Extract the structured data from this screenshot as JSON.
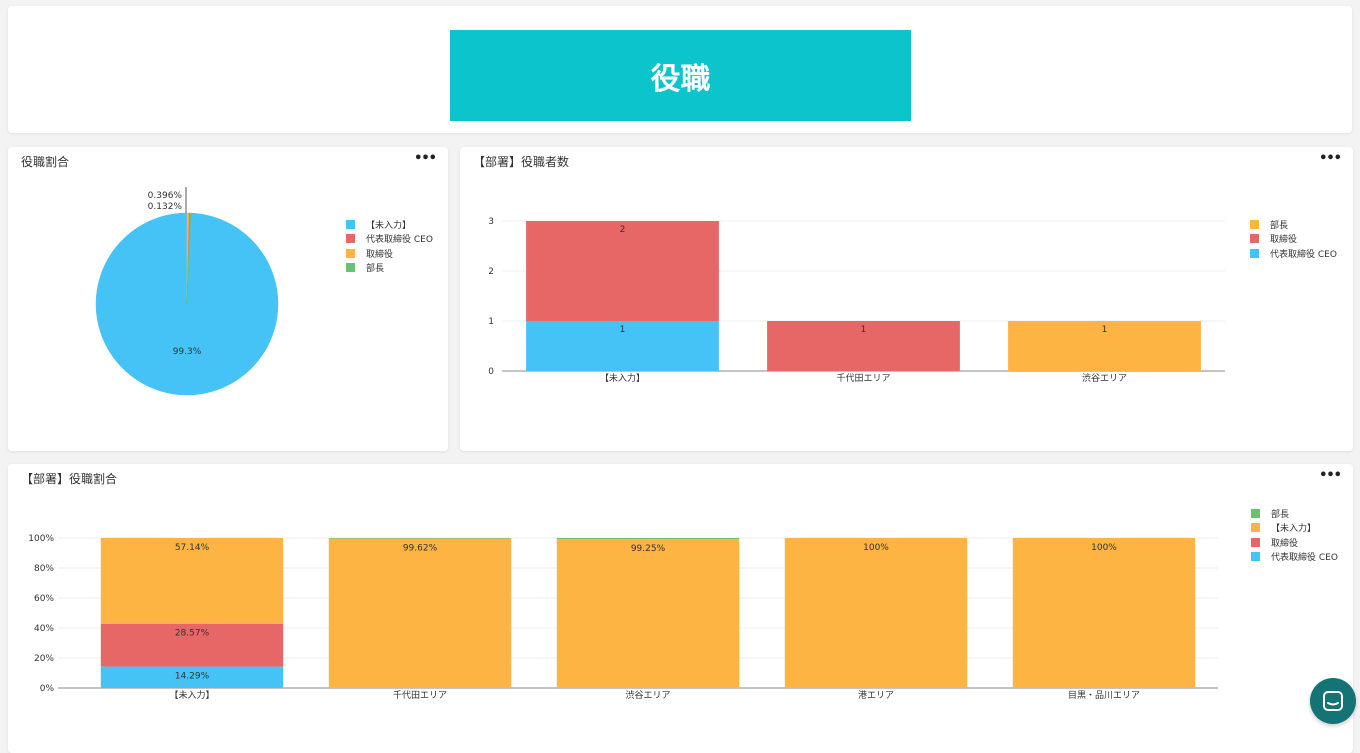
{
  "banner": {
    "title": "役職",
    "color": "#0cc4cb"
  },
  "colors": {
    "blue": "#45c3f7",
    "red": "#e66766",
    "orange": "#fdb443",
    "green": "#6cc070"
  },
  "menu_icon": "more-horizontal-icon",
  "chat_icon": "chat-bubble-icon",
  "chart_data": [
    {
      "type": "pie",
      "title": "役職割合",
      "legend": [
        {
          "name": "【未入力】",
          "color": "#45c3f7"
        },
        {
          "name": "代表取締役 CEO",
          "color": "#e66766"
        },
        {
          "name": "取締役",
          "color": "#fdb443"
        },
        {
          "name": "部長",
          "color": "#6cc070"
        }
      ],
      "slices": [
        {
          "name": "【未入力】",
          "value": 99.3,
          "label": "99.3%",
          "color": "#45c3f7"
        },
        {
          "name": "取締役",
          "value": 0.396,
          "label": "0.396%",
          "color": "#fdb443"
        },
        {
          "name": "代表取締役 CEO",
          "value": 0.132,
          "label": "0.132%",
          "color": "#e66766"
        },
        {
          "name": "部長",
          "value": 0.132,
          "label": "",
          "color": "#6cc070"
        }
      ]
    },
    {
      "type": "bar",
      "stacked": true,
      "title": "【部署】役職者数",
      "categories": [
        "【未入力】",
        "千代田エリア",
        "渋谷エリア"
      ],
      "ylim": [
        0,
        3
      ],
      "yticks": [
        "0",
        "1",
        "2",
        "3"
      ],
      "legend": [
        {
          "name": "部長",
          "color": "#fdb443"
        },
        {
          "name": "取締役",
          "color": "#e66766"
        },
        {
          "name": "代表取締役 CEO",
          "color": "#45c3f7"
        }
      ],
      "series": [
        {
          "name": "代表取締役 CEO",
          "color": "#45c3f7",
          "values": [
            1,
            0,
            0
          ]
        },
        {
          "name": "取締役",
          "color": "#e66766",
          "values": [
            2,
            1,
            0
          ]
        },
        {
          "name": "部長",
          "color": "#fdb443",
          "values": [
            0,
            0,
            1
          ]
        }
      ]
    },
    {
      "type": "bar",
      "stacked": true,
      "percent": true,
      "title": "【部署】役職割合",
      "categories": [
        "【未入力】",
        "千代田エリア",
        "渋谷エリア",
        "港エリア",
        "目黒・品川エリア"
      ],
      "ylim": [
        0,
        100
      ],
      "yticks": [
        "0%",
        "20%",
        "40%",
        "60%",
        "80%",
        "100%"
      ],
      "legend": [
        {
          "name": "部長",
          "color": "#6cc070"
        },
        {
          "name": "【未入力】",
          "color": "#fdb443"
        },
        {
          "name": "取締役",
          "color": "#e66766"
        },
        {
          "name": "代表取締役 CEO",
          "color": "#45c3f7"
        }
      ],
      "series": [
        {
          "name": "代表取締役 CEO",
          "color": "#45c3f7",
          "values": [
            14.29,
            0,
            0,
            0,
            0
          ],
          "labels": [
            "14.29%",
            "",
            "",
            "",
            ""
          ]
        },
        {
          "name": "取締役",
          "color": "#e66766",
          "values": [
            28.57,
            0,
            0,
            0,
            0
          ],
          "labels": [
            "28.57%",
            "",
            "",
            "",
            ""
          ]
        },
        {
          "name": "【未入力】",
          "color": "#fdb443",
          "values": [
            57.14,
            99.62,
            99.25,
            100,
            100
          ],
          "labels": [
            "57.14%",
            "99.62%",
            "99.25%",
            "100%",
            "100%"
          ]
        },
        {
          "name": "部長",
          "color": "#6cc070",
          "values": [
            0,
            0.38,
            0.75,
            0,
            0
          ],
          "labels": [
            "",
            "",
            "",
            "",
            ""
          ]
        }
      ]
    }
  ]
}
